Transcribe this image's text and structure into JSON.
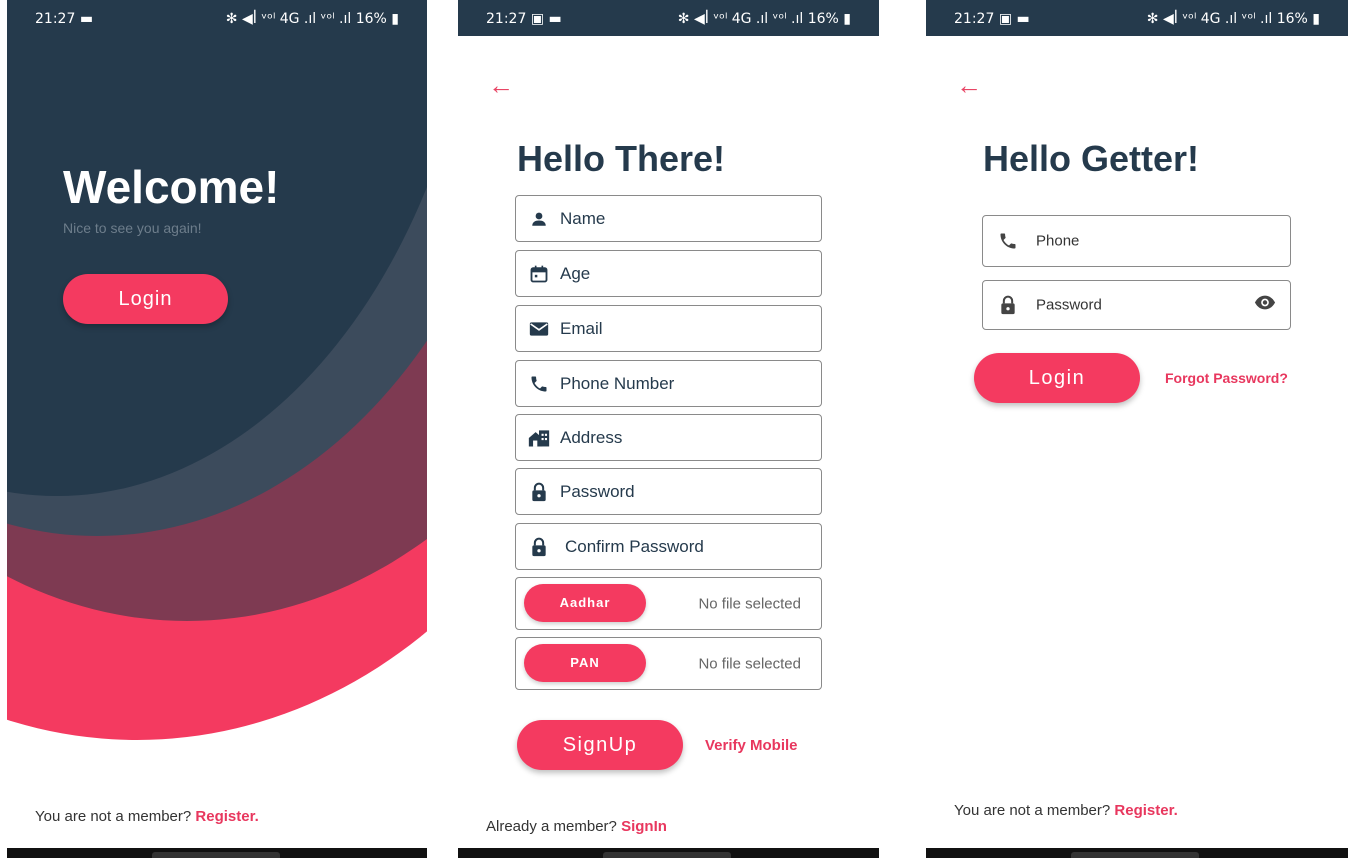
{
  "status": {
    "time": "21:27",
    "right_icons": "✻ ◀ꟾ ᵛᵒˡ 4G .ıl ᵛᵒˡ .ıl",
    "battery": "16%"
  },
  "welcome_screen": {
    "title": "Welcome!",
    "subtitle": "Nice to see you again!",
    "login_label": "Login",
    "footer_prefix": "You are not a member?",
    "footer_link": "Register."
  },
  "signup_screen": {
    "title": "Hello There!",
    "fields": [
      "Name",
      "Age",
      "Email",
      "Phone Number",
      "Address",
      "Password",
      "Confirm Password"
    ],
    "aadhar_label": "Aadhar",
    "pan_label": "PAN",
    "no_file": "No file selected",
    "signup_label": "SignUp",
    "verify_label": "Verify Mobile",
    "footer_prefix": "Already a member?",
    "footer_link": "SignIn"
  },
  "login_screen": {
    "title": "Hello Getter!",
    "phone_placeholder": "Phone",
    "password_placeholder": "Password",
    "login_label": "Login",
    "forgot_label": "Forgot Password?",
    "footer_prefix": "You are not a member?",
    "footer_link": "Register."
  },
  "colors": {
    "navy": "#253a4c",
    "accent": "#f43a60",
    "maroon": "#7e3a52"
  }
}
